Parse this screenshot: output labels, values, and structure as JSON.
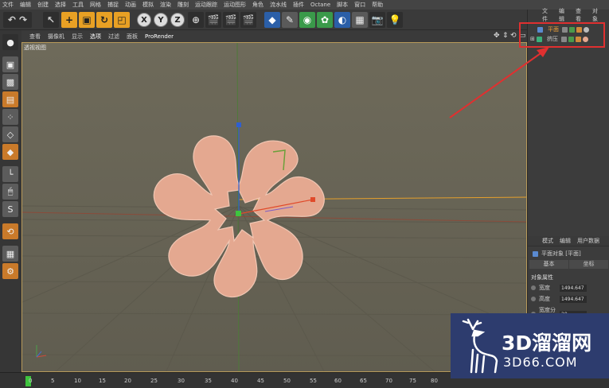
{
  "menu": [
    "文件",
    "编辑",
    "创建",
    "选择",
    "工具",
    "网格",
    "捕捉",
    "动画",
    "模拟",
    "渲染",
    "雕刻",
    "运动跟踪",
    "运动图形",
    "角色",
    "流水线",
    "插件",
    "Octane",
    "脚本",
    "窗口",
    "帮助"
  ],
  "viewport": {
    "menu": [
      "查看",
      "摄像机",
      "显示",
      "选项",
      "过滤",
      "面板",
      "ProRender"
    ],
    "label": "透视视图"
  },
  "object_manager": {
    "menu": [
      "文件",
      "编辑",
      "查看",
      "对象"
    ],
    "objects": [
      {
        "name": "平面",
        "selected": true
      },
      {
        "name": "挤压",
        "selected": false
      }
    ]
  },
  "attributes": {
    "menu": [
      "模式",
      "编辑",
      "用户数据"
    ],
    "object_title": "平面对象 [平面]",
    "tabs": [
      "基本",
      "坐标"
    ],
    "section": "对象属性",
    "fields": [
      {
        "label": "宽度",
        "value": "1494.647"
      },
      {
        "label": "高度",
        "value": "1494.647"
      },
      {
        "label": "宽度分段",
        "value": "20"
      }
    ]
  },
  "timeline": {
    "ticks": [
      "0",
      "5",
      "10",
      "15",
      "20",
      "25",
      "30",
      "35",
      "40",
      "45",
      "50",
      "55",
      "60",
      "65",
      "70",
      "75",
      "80"
    ]
  },
  "watermark": {
    "brand": "3D溜溜网",
    "url": "3D66.COM"
  },
  "colors": {
    "shape_fill": "#e4a890",
    "viewport_bg": "#6a6656",
    "accent_orange": "#e8a024",
    "highlight_red": "#e03030"
  }
}
